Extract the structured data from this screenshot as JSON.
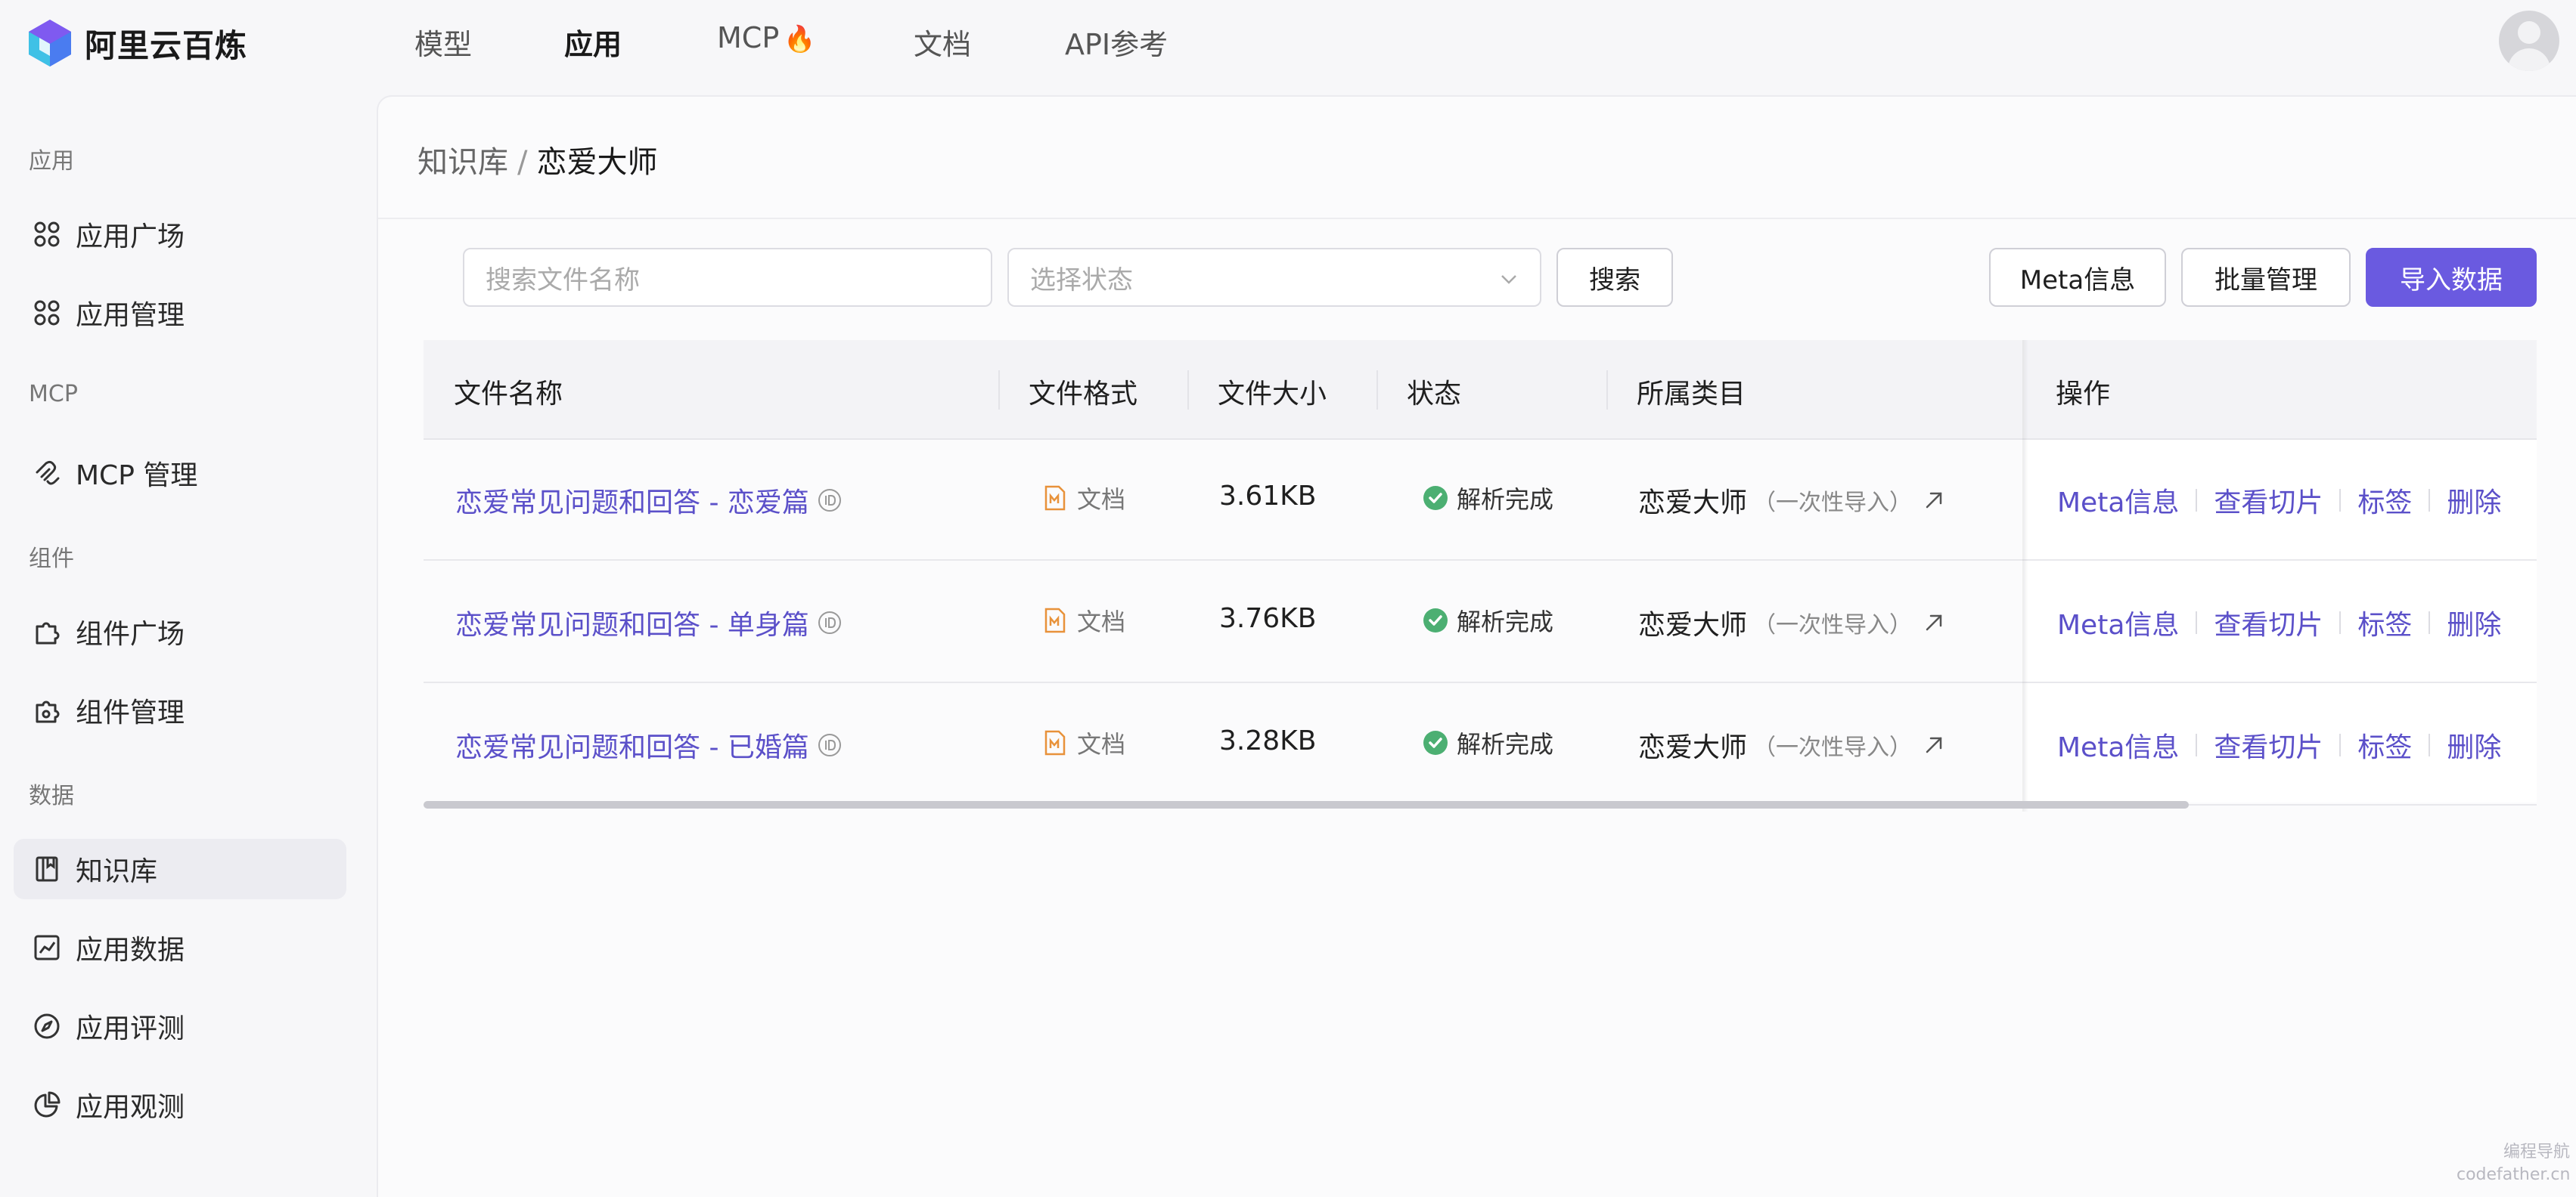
{
  "app": {
    "name": "阿里云百炼"
  },
  "topnav": [
    {
      "label": "模型",
      "active": false
    },
    {
      "label": "应用",
      "active": true
    },
    {
      "label": "MCP",
      "active": false,
      "badge": "🔥"
    },
    {
      "label": "文档",
      "active": false
    },
    {
      "label": "API参考",
      "active": false
    }
  ],
  "sidebar": {
    "groups": [
      {
        "label": "应用"
      },
      {
        "label": "MCP"
      },
      {
        "label": "组件"
      },
      {
        "label": "数据"
      }
    ],
    "items": [
      {
        "label": "应用广场",
        "icon": "grid-icon",
        "active": false
      },
      {
        "label": "应用管理",
        "icon": "grid-icon",
        "active": false
      },
      {
        "label": "MCP 管理",
        "icon": "mcp-icon",
        "active": false
      },
      {
        "label": "组件广场",
        "icon": "puzzle-icon",
        "active": false
      },
      {
        "label": "组件管理",
        "icon": "puzzle-gear-icon",
        "active": false
      },
      {
        "label": "知识库",
        "icon": "book-icon",
        "active": true
      },
      {
        "label": "应用数据",
        "icon": "chart-icon",
        "active": false
      },
      {
        "label": "应用评测",
        "icon": "compass-icon",
        "active": false
      },
      {
        "label": "应用观测",
        "icon": "pie-icon",
        "active": false
      }
    ]
  },
  "breadcrumb": {
    "parent": "知识库",
    "separator": "/",
    "current": "恋爱大师"
  },
  "toolbar": {
    "search_placeholder": "搜索文件名称",
    "status_placeholder": "选择状态",
    "search_button": "搜索",
    "meta_button": "Meta信息",
    "batch_button": "批量管理",
    "import_button": "导入数据"
  },
  "table": {
    "headers": {
      "name": "文件名称",
      "format": "文件格式",
      "size": "文件大小",
      "status": "状态",
      "category": "所属类目",
      "actions": "操作"
    },
    "rows": [
      {
        "name": "恋爱常见问题和回答 - 恋爱篇",
        "format": "文档",
        "size": "3.61KB",
        "status": "解析完成",
        "category": "恋爱大师",
        "category_note": "（一次性导入）"
      },
      {
        "name": "恋爱常见问题和回答 - 单身篇",
        "format": "文档",
        "size": "3.76KB",
        "status": "解析完成",
        "category": "恋爱大师",
        "category_note": "（一次性导入）"
      },
      {
        "name": "恋爱常见问题和回答 - 已婚篇",
        "format": "文档",
        "size": "3.28KB",
        "status": "解析完成",
        "category": "恋爱大师",
        "category_note": "（一次性导入）"
      }
    ],
    "actions": {
      "meta": "Meta信息",
      "chunks": "查看切片",
      "tags": "标签",
      "delete": "删除"
    }
  },
  "watermark": {
    "line1": "编程导航",
    "line2": "codefather.cn"
  },
  "colors": {
    "accent": "#6a5ae0",
    "link": "#5b50c9",
    "success": "#4caf72"
  }
}
